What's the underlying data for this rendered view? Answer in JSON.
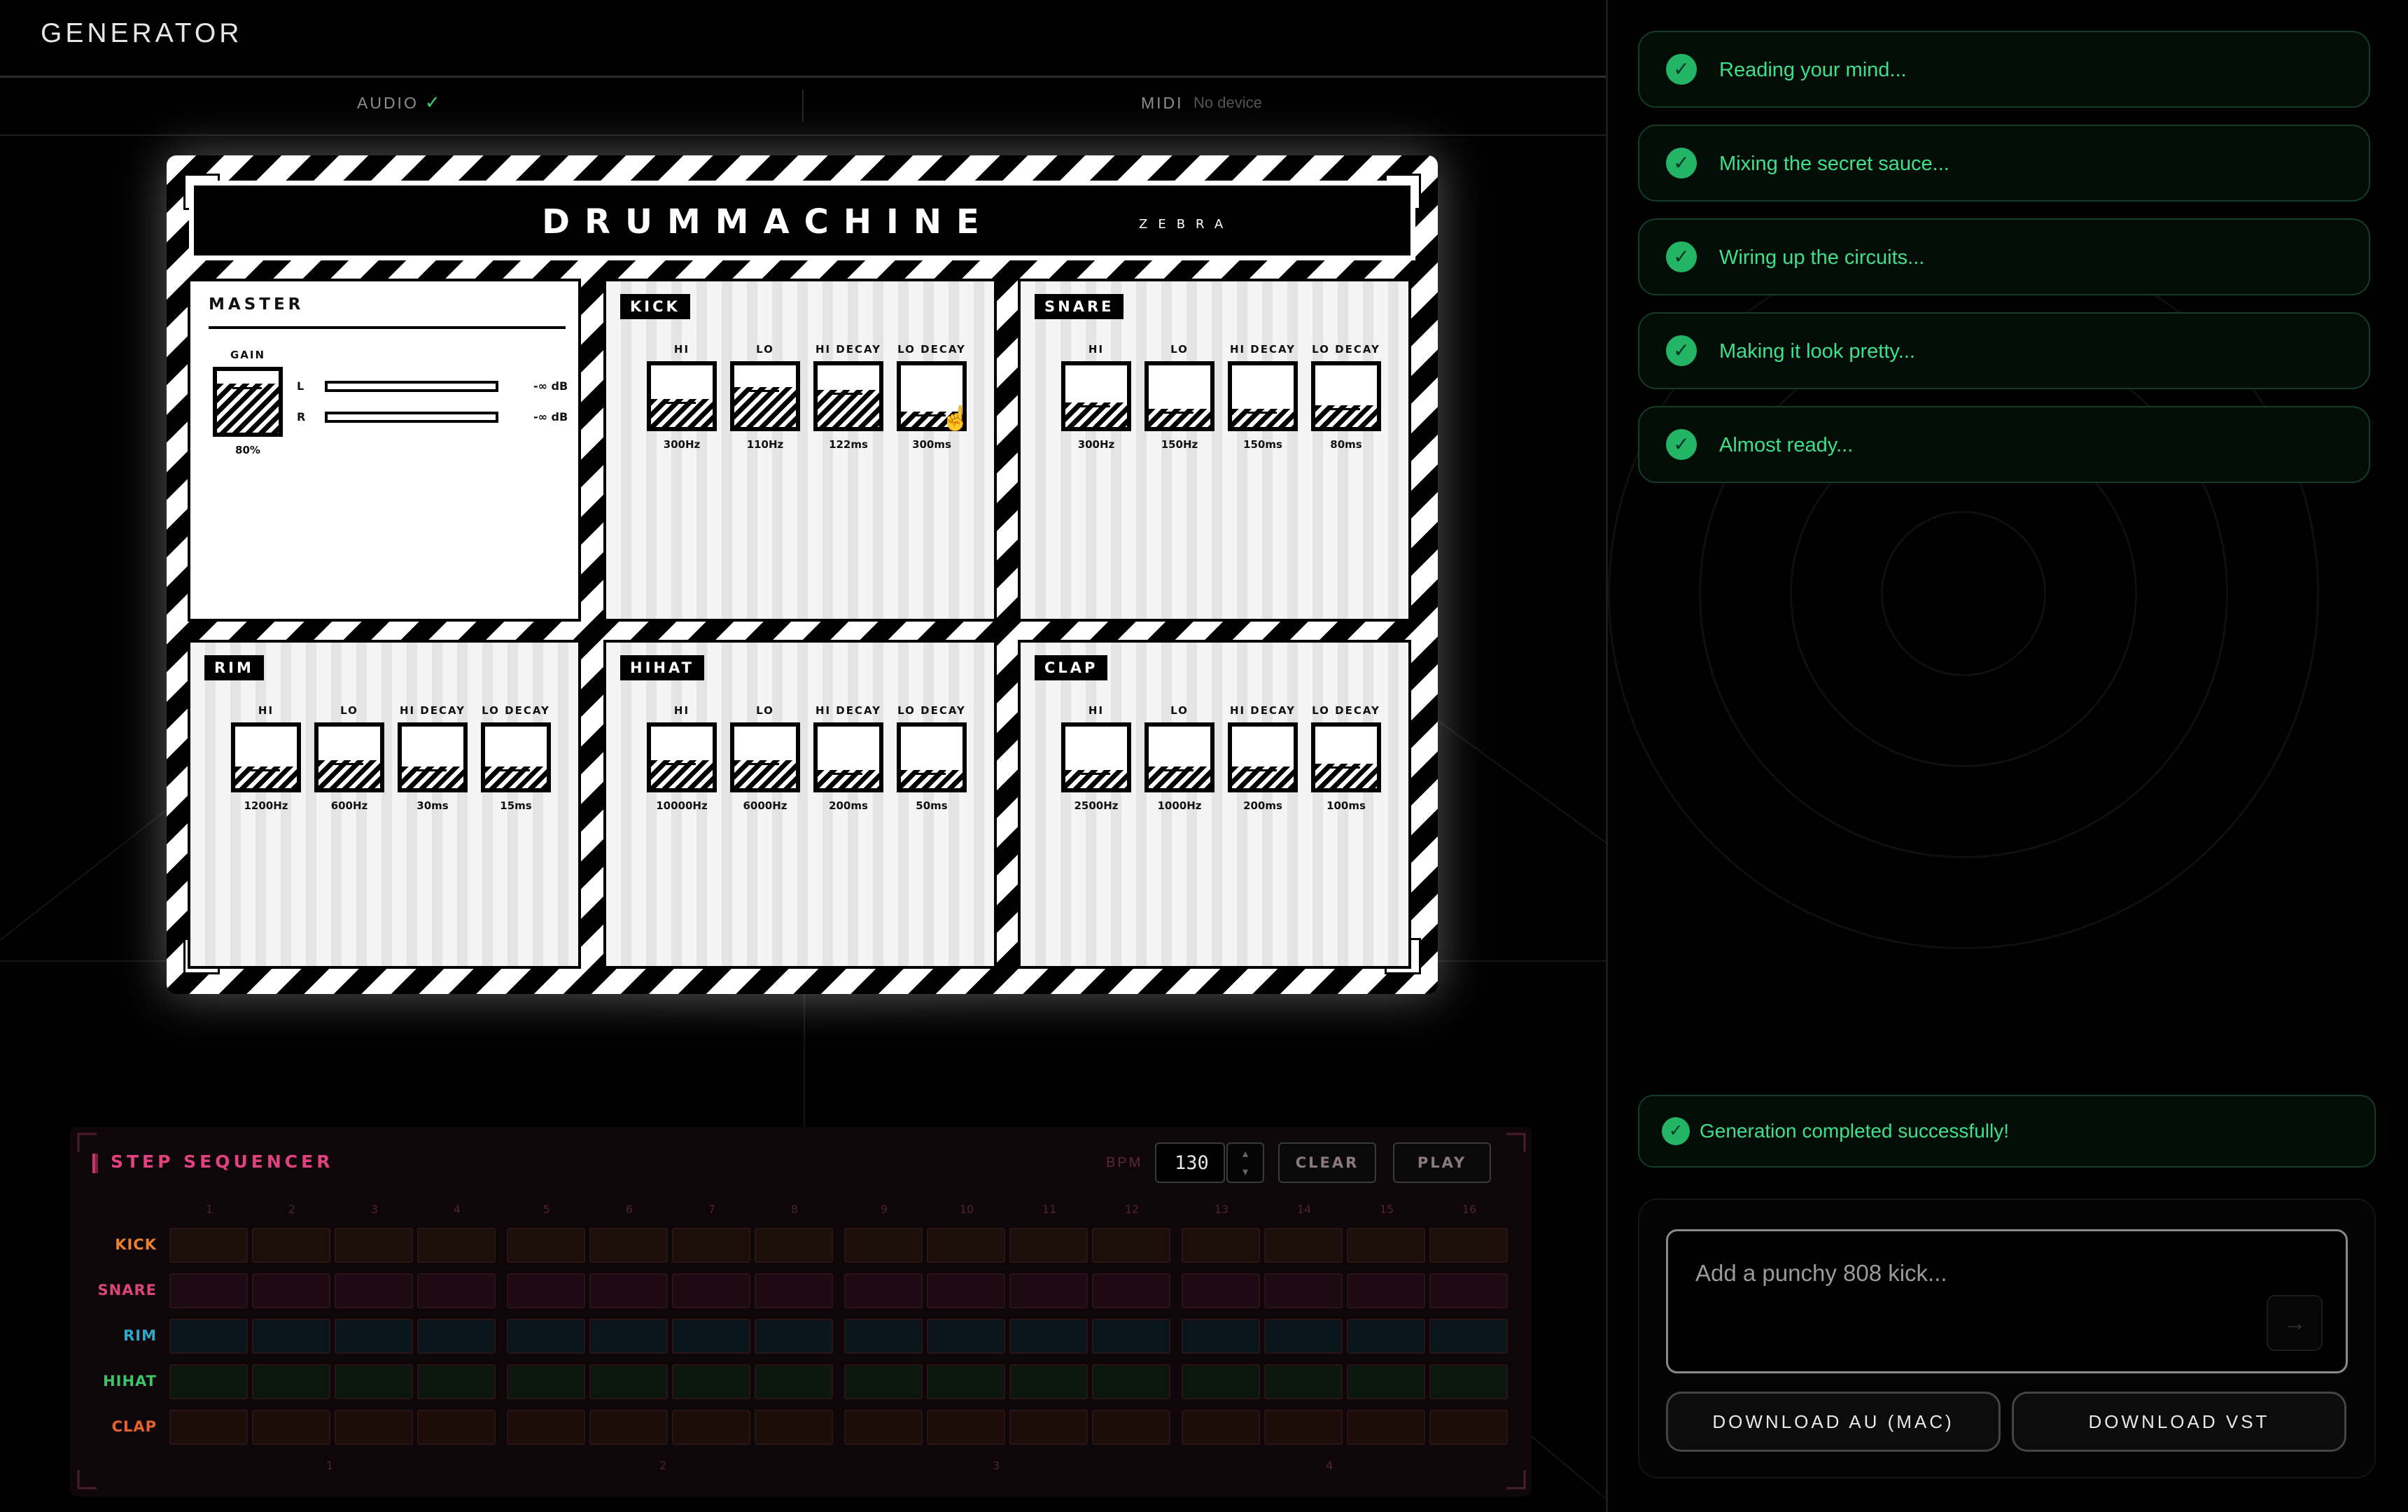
{
  "header": {
    "title": "GENERATOR",
    "tabs": [
      {
        "label": "AUDIO",
        "status": "✓"
      },
      {
        "label": "MIDI",
        "status": "No device"
      }
    ]
  },
  "plugin": {
    "title": "DRUMMACHINE",
    "subtitle": "ZEBRA",
    "master": {
      "title": "MASTER",
      "gain": {
        "label": "GAIN",
        "value": "80%",
        "level": 0.8
      },
      "meters": [
        {
          "channel": "L",
          "value": "-∞ dB"
        },
        {
          "channel": "R",
          "value": "-∞ dB"
        }
      ]
    },
    "sections": [
      {
        "name": "KICK",
        "knobs": [
          {
            "label": "HI",
            "value": "300Hz",
            "level": 0.45
          },
          {
            "label": "LO",
            "value": "110Hz",
            "level": 0.65
          },
          {
            "label": "HI DECAY",
            "value": "122ms",
            "level": 0.6
          },
          {
            "label": "LO DECAY",
            "value": "300ms",
            "level": 0.25
          }
        ]
      },
      {
        "name": "SNARE",
        "knobs": [
          {
            "label": "HI",
            "value": "300Hz",
            "level": 0.4
          },
          {
            "label": "LO",
            "value": "150Hz",
            "level": 0.3
          },
          {
            "label": "HI DECAY",
            "value": "150ms",
            "level": 0.3
          },
          {
            "label": "LO DECAY",
            "value": "80ms",
            "level": 0.35
          }
        ]
      },
      {
        "name": "RIM",
        "knobs": [
          {
            "label": "HI",
            "value": "1200Hz",
            "level": 0.35
          },
          {
            "label": "LO",
            "value": "600Hz",
            "level": 0.45
          },
          {
            "label": "HI DECAY",
            "value": "30ms",
            "level": 0.35
          },
          {
            "label": "LO DECAY",
            "value": "15ms",
            "level": 0.35
          }
        ]
      },
      {
        "name": "HIHAT",
        "knobs": [
          {
            "label": "HI",
            "value": "10000Hz",
            "level": 0.45
          },
          {
            "label": "LO",
            "value": "6000Hz",
            "level": 0.45
          },
          {
            "label": "HI DECAY",
            "value": "200ms",
            "level": 0.3
          },
          {
            "label": "LO DECAY",
            "value": "50ms",
            "level": 0.3
          }
        ]
      },
      {
        "name": "CLAP",
        "knobs": [
          {
            "label": "HI",
            "value": "2500Hz",
            "level": 0.3
          },
          {
            "label": "LO",
            "value": "1000Hz",
            "level": 0.35
          },
          {
            "label": "HI DECAY",
            "value": "200ms",
            "level": 0.35
          },
          {
            "label": "LO DECAY",
            "value": "100ms",
            "level": 0.4
          }
        ]
      }
    ]
  },
  "sequencer": {
    "title": "STEP SEQUENCER",
    "bpm_label": "BPM",
    "bpm_value": "130",
    "clear_label": "CLEAR",
    "play_label": "PLAY",
    "steps": [
      "1",
      "2",
      "3",
      "4",
      "5",
      "6",
      "7",
      "8",
      "9",
      "10",
      "11",
      "12",
      "13",
      "14",
      "15",
      "16"
    ],
    "beats": [
      "1",
      "2",
      "3",
      "4"
    ],
    "tracks": [
      {
        "name": "KICK",
        "color": "#e8822e",
        "cell_bg": "#1c0f0a"
      },
      {
        "name": "SNARE",
        "color": "#d9467a",
        "cell_bg": "#1d0a12"
      },
      {
        "name": "RIM",
        "color": "#2fa8c8",
        "cell_bg": "#08161c"
      },
      {
        "name": "HIHAT",
        "color": "#3cc46a",
        "cell_bg": "#0b170d"
      },
      {
        "name": "CLAP",
        "color": "#e8622e",
        "cell_bg": "#1c0d08"
      }
    ]
  },
  "status": {
    "steps": [
      "Reading your mind...",
      "Mixing the secret sauce...",
      "Wiring up the circuits...",
      "Making it look pretty...",
      "Almost ready..."
    ],
    "complete": "Generation completed successfully!",
    "check_icon": "check-icon"
  },
  "prompt": {
    "placeholder": "Add a punchy 808 kick...",
    "send_icon": "arrow-right-icon"
  },
  "downloads": {
    "au": "DOWNLOAD AU (MAC)",
    "vst": "DOWNLOAD VST"
  },
  "colors": {
    "accent_green": "#3ee08a",
    "sequencer_accent": "#e04280"
  }
}
